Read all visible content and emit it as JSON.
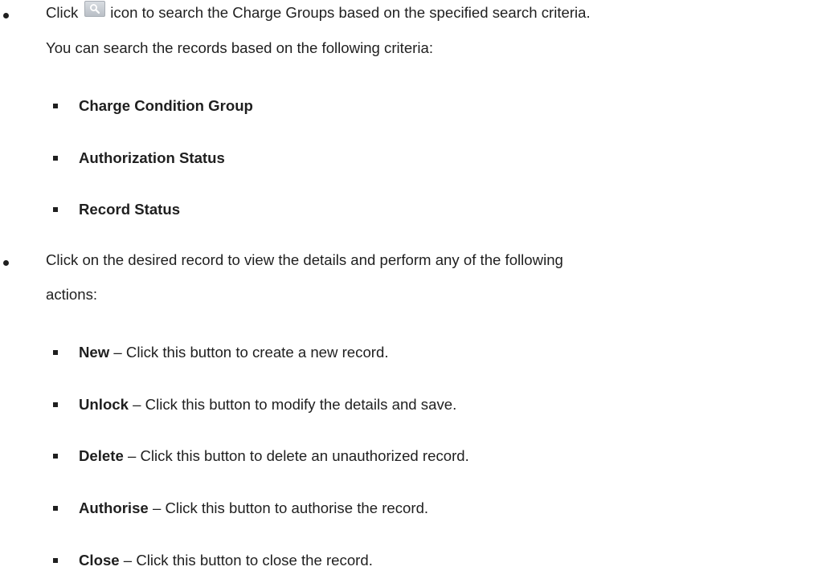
{
  "bullets": [
    {
      "lines": {
        "a_before_icon": "Click",
        "a_after_icon": "icon to search the Charge Groups based on the specified search criteria.",
        "b": "You can search the records based on the following criteria:"
      },
      "icon": "search-icon",
      "criteria": [
        "Charge Condition Group",
        "Authorization Status",
        "Record Status"
      ]
    },
    {
      "lines": {
        "a": "Click on the desired record to view the details and perform any of the following",
        "b": "actions:"
      },
      "actions": [
        {
          "name": "New",
          "desc": " – Click this button to create a new record."
        },
        {
          "name": "Unlock",
          "desc": " – Click this button to modify the details and save."
        },
        {
          "name": "Delete",
          "desc": " – Click this button to delete an unauthorized record."
        },
        {
          "name": "Authorise",
          "desc": " – Click this button to authorise the record."
        },
        {
          "name": "Close",
          "desc": " – Click this button to close the record."
        }
      ]
    }
  ]
}
